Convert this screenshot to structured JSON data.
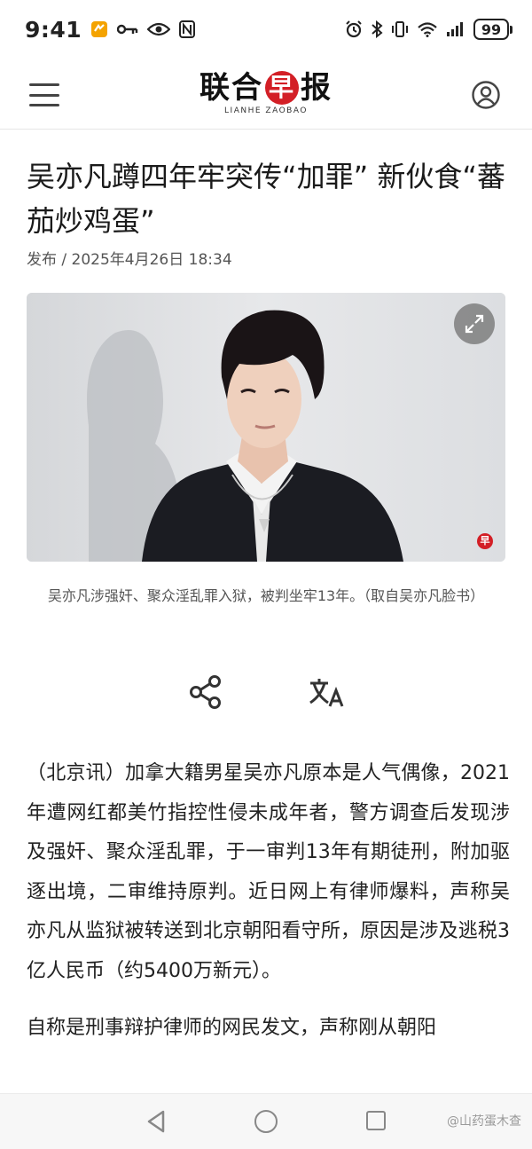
{
  "status_bar": {
    "time": "9:41",
    "battery": "99",
    "icons": [
      "app-badge-icon",
      "key-icon",
      "eye-icon",
      "nfc-icon",
      "alarm-icon",
      "bluetooth-icon",
      "vibrate-icon",
      "wifi-icon",
      "signal-icon"
    ]
  },
  "header": {
    "brand_cn_1": "联合",
    "brand_cn_zao": "早",
    "brand_cn_2": "报",
    "brand_en": "LIANHE ZAOBAO",
    "menu_icon": "hamburger-menu-icon",
    "user_icon": "user-account-icon",
    "accent_color": "#d31f26"
  },
  "article": {
    "title": "吴亦凡蹲四年牢突传“加罪” 新伙食“蕃茄炒鸡蛋”",
    "meta": "发布 / 2025年4月26日 18:34",
    "photo_caption": "吴亦凡涉强奸、聚众淫乱罪入狱，被判坐牢13年。（取自吴亦凡脸书）",
    "photo_badge": "早",
    "paragraphs": [
      "（北京讯）加拿大籍男星吴亦凡原本是人气偶像，2021年遭网红都美竹指控性侵未成年者，警方调查后发现涉及强奸、聚众淫乱罪，于一审判13年有期徒刑，附加驱逐出境，二审维持原判。近日网上有律师爆料，声称吴亦凡从监狱被转送到北京朝阳看守所，原因是涉及逃税3亿人民币（约5400万新元）。",
      "自称是刑事辩护律师的网民发文，声称刚从朝阳"
    ]
  },
  "actions": {
    "share_icon": "share-icon",
    "translate_icon": "translate-icon"
  },
  "nav_bar": {
    "watermark": "@山药蛋木查"
  }
}
